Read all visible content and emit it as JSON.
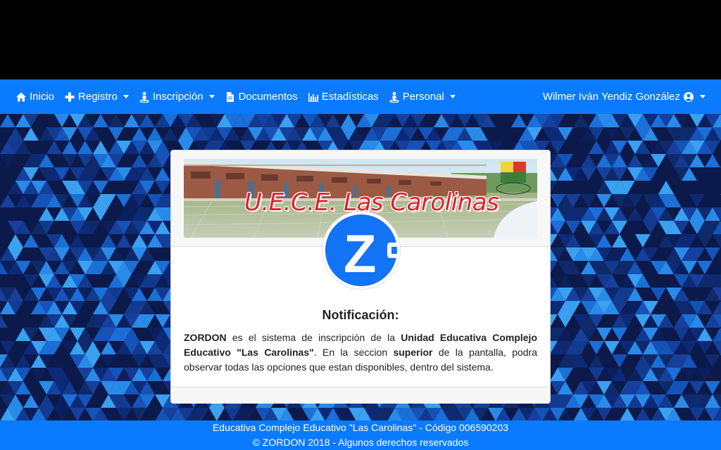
{
  "navbar": {
    "items": [
      {
        "label": "Inicio",
        "icon": "home-icon",
        "dropdown": false
      },
      {
        "label": "Registro",
        "icon": "plus-icon",
        "dropdown": true
      },
      {
        "label": "Inscripción",
        "icon": "person-icon",
        "dropdown": true
      },
      {
        "label": "Documentos",
        "icon": "file-icon",
        "dropdown": false
      },
      {
        "label": "Estadísticas",
        "icon": "bar-chart-icon",
        "dropdown": false
      },
      {
        "label": "Personal",
        "icon": "person-icon",
        "dropdown": true
      }
    ],
    "user_name": "Wilmer Iván Yendiz González",
    "user_icon": "user-circle-icon"
  },
  "banner": {
    "title": "U.E.C.E. Las Carolinas"
  },
  "logo": {
    "letter": "Z"
  },
  "notification": {
    "title": "Notificación:",
    "p1_bold": "ZORDON",
    "p2": " es el sistema de inscripción de la ",
    "p3_bold": "Unidad Educativa Complejo Educativo \"Las Carolinas\"",
    "p4": ". En la seccion ",
    "p5_bold": "superior",
    "p6": " de la pantalla, podra observar todas las opciones que estan disponibles, dentro del sistema."
  },
  "footer": {
    "line1": "Educativa Complejo Educativo \"Las Carolinas\" - Código 006590203",
    "line2": "© ZORDON 2018 - Algunos derechos reservados"
  },
  "colors": {
    "navbar": "#0a7bff",
    "background_dark": "#0d1e52",
    "logo_blue": "#1273f5",
    "banner_title": "#e41d2a"
  }
}
